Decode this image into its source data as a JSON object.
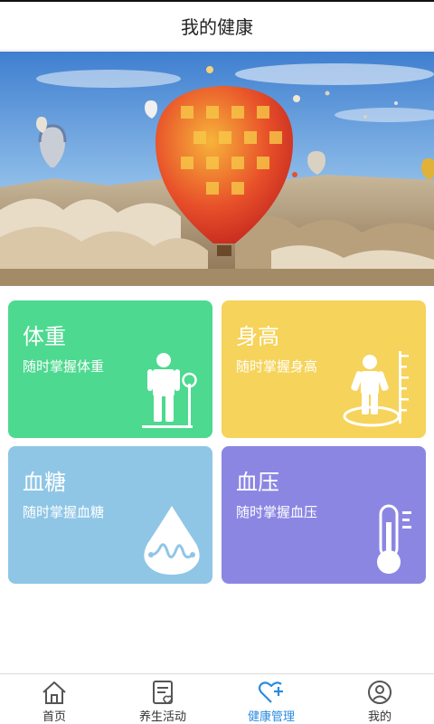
{
  "header": {
    "title": "我的健康"
  },
  "cards": [
    {
      "title": "体重",
      "subtitle": "随时掌握体重",
      "color": "#4dd98f",
      "icon": "person-scale-icon"
    },
    {
      "title": "身高",
      "subtitle": "随时掌握身高",
      "color": "#f6d35a",
      "icon": "person-height-icon"
    },
    {
      "title": "血糖",
      "subtitle": "随时掌握血糖",
      "color": "#8fc6e6",
      "icon": "blood-drop-icon"
    },
    {
      "title": "血压",
      "subtitle": "随时掌握血压",
      "color": "#8c86e3",
      "icon": "thermometer-icon"
    }
  ],
  "tabs": [
    {
      "label": "首页",
      "icon": "home-icon",
      "active": false
    },
    {
      "label": "养生活动",
      "icon": "activity-list-icon",
      "active": false
    },
    {
      "label": "健康管理",
      "icon": "heart-plus-icon",
      "active": true
    },
    {
      "label": "我的",
      "icon": "profile-icon",
      "active": false
    }
  ],
  "colors": {
    "accent": "#2b8be0",
    "tab_inactive": "#555555"
  }
}
